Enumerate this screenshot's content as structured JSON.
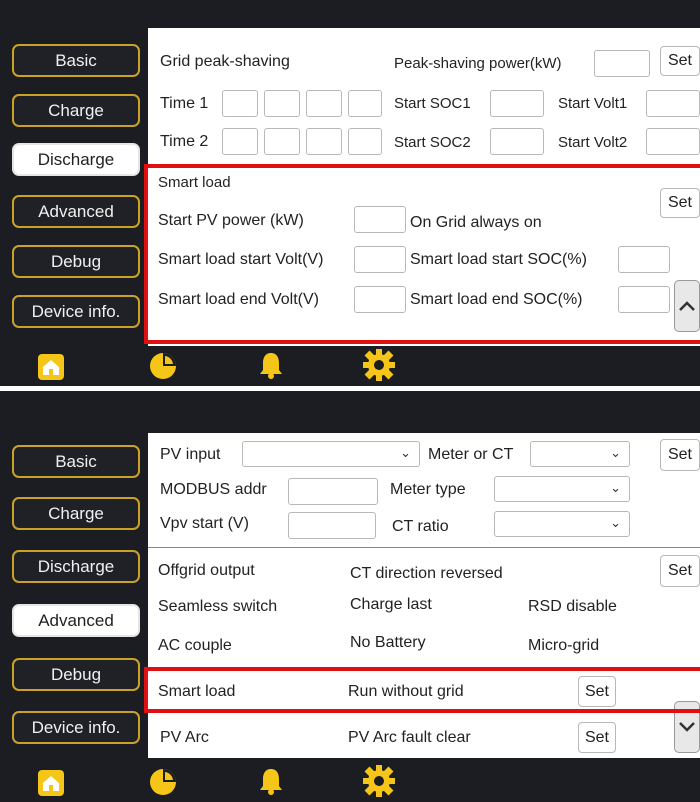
{
  "colors": {
    "accent": "#c9a227",
    "icon_yellow": "#f5c518",
    "highlight": "#e01010",
    "panel_bg": "#1b1d22"
  },
  "top": {
    "sidebar": [
      "Basic",
      "Charge",
      "Discharge",
      "Advanced",
      "Debug",
      "Device info."
    ],
    "active": "Discharge",
    "grid_peak_shaving": "Grid peak-shaving",
    "peak_shaving_power": "Peak-shaving power(kW)",
    "set": "Set",
    "time1": "Time 1",
    "time2": "Time 2",
    "start_soc1": "Start SOC1",
    "start_soc2": "Start SOC2",
    "start_volt1": "Start Volt1",
    "start_volt2": "Start Volt2",
    "smart_load": "Smart load",
    "start_pv_power": "Start PV power (kW)",
    "on_grid_always_on": "On Grid always on",
    "smart_load_start_volt": "Smart load start Volt(V)",
    "smart_load_start_soc": "Smart load start SOC(%)",
    "smart_load_end_volt": "Smart load end Volt(V)",
    "smart_load_end_soc": "Smart load end SOC(%)"
  },
  "bottom": {
    "sidebar": [
      "Basic",
      "Charge",
      "Discharge",
      "Advanced",
      "Debug",
      "Device info."
    ],
    "active": "Advanced",
    "pv_input": "PV input",
    "meter_or_ct": "Meter or CT",
    "modbus_addr": "MODBUS addr",
    "meter_type": "Meter type",
    "vpv_start": "Vpv start (V)",
    "ct_ratio": "CT ratio",
    "offgrid_output": "Offgrid output",
    "ct_direction_reversed": "CT direction reversed",
    "seamless_switch": "Seamless switch",
    "charge_last": "Charge last",
    "rsd_disable": "RSD disable",
    "ac_couple": "AC couple",
    "no_battery": "No Battery",
    "micro_grid": "Micro-grid",
    "smart_load": "Smart load",
    "run_without_grid": "Run without grid",
    "pv_arc": "PV Arc",
    "pv_arc_fault_clear": "PV Arc fault clear",
    "set": "Set"
  },
  "tabbar_icons": [
    "home-icon",
    "pie-chart-icon",
    "bell-icon",
    "gear-icon"
  ]
}
